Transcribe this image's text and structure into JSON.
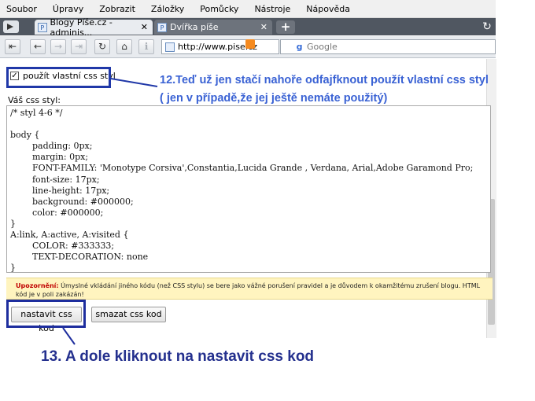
{
  "menu": [
    "Soubor",
    "Úpravy",
    "Zobrazit",
    "Záložky",
    "Pomůcky",
    "Nástroje",
    "Nápověda"
  ],
  "tabs": [
    {
      "label": "Blogy Píše.cz - adminis...",
      "close": "✕"
    },
    {
      "label": "Dvířka píše",
      "close": "✕"
    }
  ],
  "new_tab_label": "+",
  "toolbar": {
    "back": "⇤",
    "prev": "←",
    "next": "→",
    "end": "⇥",
    "reload": "↻",
    "home": "⌂",
    "info": "ℹ"
  },
  "url": "http://www.pise.cz",
  "search_placeholder": "Google",
  "search_engine_letter": "g",
  "page": {
    "checkbox_label": "použít vlastní css styl",
    "checkbox_checked": "✓",
    "style_label": "Váš css styl:",
    "css_code": "/* styl 4-6 */\n\nbody {\n        padding: 0px;\n        margin: 0px;\n        FONT-FAMILY: 'Monotype Corsiva',Constantia,Lucida Grande , Verdana, Arial,Adobe Garamond Pro;\n        font-size: 17px;\n        line-height: 17px;\n        background: #000000;\n        color: #000000;\n}\nA:link, A:active, A:visited {\n        COLOR: #333333;\n        TEXT-DECORATION: none\n}",
    "warning_title": "Upozornění:",
    "warning_text": "Úmyslné vkládání jiného kódu (než CSS stylu) se bere jako vážné porušení pravidel a je důvodem k okamžitému zrušení blogu. HTML kód je v poli zakázán!",
    "set_button": "nastavit css kod",
    "delete_button": "smazat css kod"
  },
  "annotations": {
    "step12": "12.Teď už jen stačí nahoře odfajfknout použít vlastní css styl ( jen v případě,že jej ještě nemáte použitý)",
    "step13": "13. A dole kliknout na nastavit css kod"
  },
  "colors": {
    "annotation_box": "#2038a8",
    "annotation_text_12": "#3a62d4",
    "annotation_text_13": "#24308e",
    "warning_bg": "#fff4bf",
    "warning_title": "#c00000"
  }
}
